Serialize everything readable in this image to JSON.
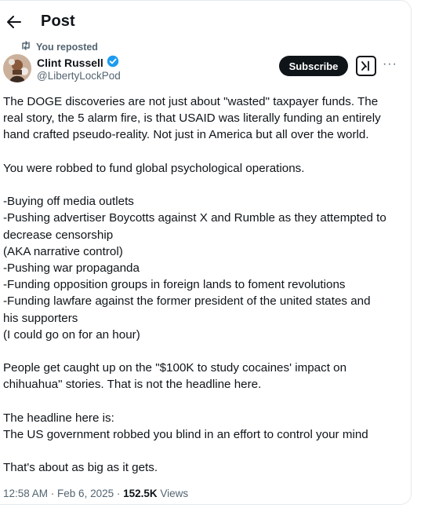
{
  "header": {
    "title": "Post"
  },
  "repost": {
    "label": "You reposted"
  },
  "author": {
    "name": "Clint Russell",
    "handle": "@LibertyLockPod",
    "verified_color": "#1d9bf0"
  },
  "actions": {
    "subscribe_label": "Subscribe"
  },
  "post": {
    "paragraphs": [
      [
        "The DOGE discoveries are not just about \"wasted\" taxpayer funds. The",
        "real story, the 5 alarm fire, is that USAID was literally funding an entirely",
        "hand crafted pseudo-reality. Not just in America but all over the world."
      ],
      [
        "You were robbed to fund global psychological operations."
      ],
      [
        "-Buying off media outlets",
        "-Pushing advertiser Boycotts against X and Rumble as they attempted to",
        "decrease censorship",
        "(AKA narrative control)",
        "-Pushing war propaganda",
        "-Funding opposition groups in foreign lands to foment revolutions",
        "-Funding lawfare against the former president of the united states and",
        "his supporters",
        "(I could go on for an hour)"
      ],
      [
        "People get caught up on the \"$100K to study cocaines' impact on",
        "chihuahua\" stories. That is not the headline here."
      ],
      [
        "The headline here is:",
        "The US government robbed you blind in an effort to control your mind"
      ],
      [
        "That's about as big as it gets."
      ]
    ]
  },
  "meta": {
    "time": "12:58 AM",
    "separator": " · ",
    "date": "Feb 6, 2025",
    "views_count": "152.5K",
    "views_label": " Views"
  }
}
